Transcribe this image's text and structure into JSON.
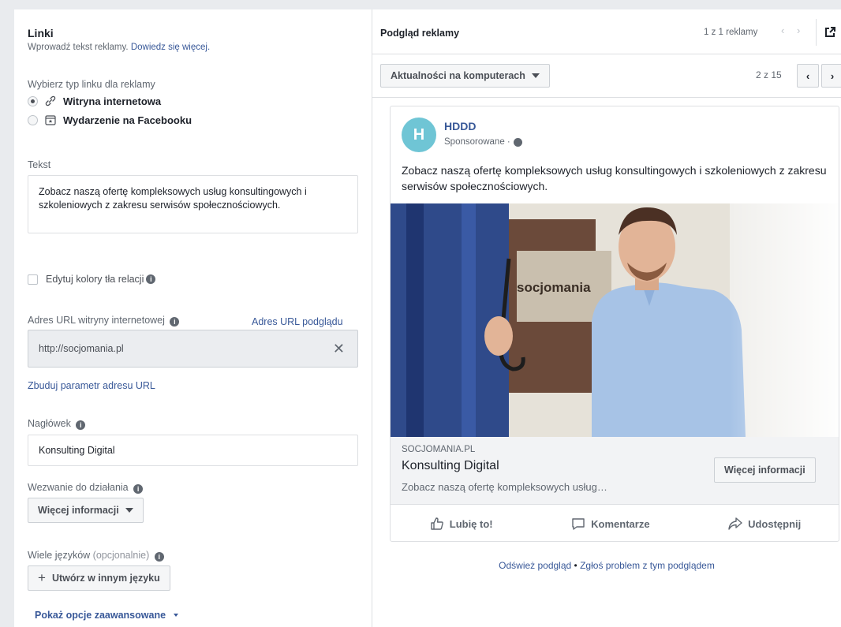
{
  "left": {
    "section_title": "Linki",
    "section_sub": "Wprowadź tekst reklamy.",
    "section_sub_link": "Dowiedz się więcej.",
    "link_type_label": "Wybierz typ linku dla reklamy",
    "link_types": [
      {
        "label": "Witryna internetowa",
        "selected": true,
        "icon": "link-icon"
      },
      {
        "label": "Wydarzenie na Facebooku",
        "selected": false,
        "icon": "event-icon"
      }
    ],
    "text_label": "Tekst",
    "text_value": "Zobacz naszą ofertę kompleksowych usług konsultingowych i szkoleniowych z zakresu serwisów społecznościowych.",
    "edit_bg_label": "Edytuj kolory tła relacji",
    "url_label": "Adres URL witryny internetowej",
    "preview_url_link": "Adres URL podglądu",
    "url_value": "http://socjomania.pl",
    "url_clear": "✕",
    "build_param_link": "Zbuduj parametr adresu URL",
    "headline_label": "Nagłówek",
    "headline_value": "Konsulting Digital",
    "cta_label": "Wezwanie do działania",
    "cta_value": "Więcej informacji",
    "languages_label": "Wiele języków",
    "languages_optional": "(opcjonalnie)",
    "create_language_btn": "Utwórz w innym języku",
    "create_language_plus": "+",
    "advanced_link": "Pokaż opcje zaawansowane"
  },
  "right": {
    "preview_title": "Podgląd reklamy",
    "ad_count": "1 z 1 reklamy",
    "nav_arrows": "‹ ›",
    "placement": "Aktualności na komputerach",
    "page_count": "2 z 15",
    "prev": "‹",
    "next": "›",
    "ad": {
      "avatar_letter": "H",
      "page_name": "HDDD",
      "sponsored": "Sponsorowane ·",
      "primary_text": "Zobacz naszą ofertę kompleksowych usług konsultingowych i szkoleniowych z zakresu serwisów społecznościowych.",
      "sign_text": "socjomania",
      "domain": "SOCJOMANIA.PL",
      "headline": "Konsulting Digital",
      "description": "Zobacz naszą ofertę kompleksowych usług…",
      "cta": "Więcej informacji",
      "like": "Lubię to!",
      "comment": "Komentarze",
      "share": "Udostępnij"
    },
    "refresh_link": "Odśwież podgląd",
    "separator": "•",
    "report_link": "Zgłoś problem z tym podglądem"
  },
  "colors": {
    "link": "#385898",
    "avatar": "#6fc5d5"
  }
}
